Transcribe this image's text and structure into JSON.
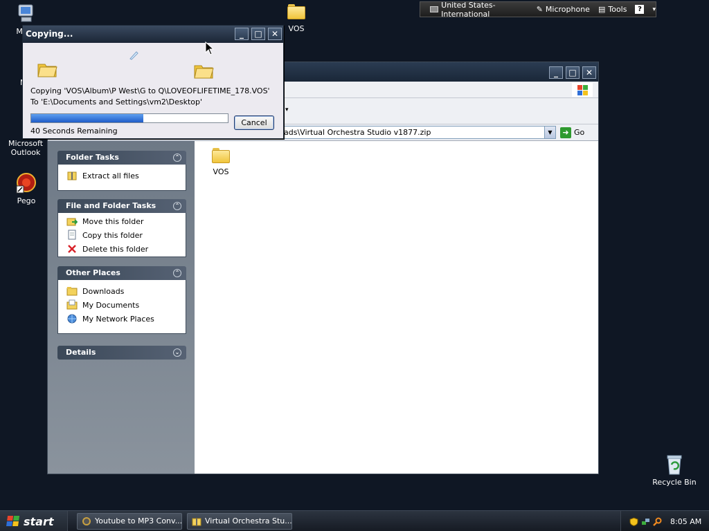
{
  "desktop": {
    "icons": [
      {
        "label": "My C",
        "icon": "my-computer-icon"
      },
      {
        "label": "My",
        "icon": "my-documents-icon"
      },
      {
        "label": "Microsoft Outlook",
        "icon": "outlook-icon"
      },
      {
        "label": "Pego",
        "icon": "pego-icon"
      },
      {
        "label": "VOS",
        "icon": "folder-icon"
      },
      {
        "label": "Recycle Bin",
        "icon": "recycle-bin-icon"
      }
    ]
  },
  "language_bar": {
    "language": "United States-International",
    "microphone": "Microphone",
    "tools": "Tools",
    "help": "?"
  },
  "explorer": {
    "address": "ads\\Virtual Orchestra Studio v1877.zip",
    "go_label": "Go",
    "panels": [
      {
        "title": "Folder Tasks",
        "items": [
          {
            "label": "Extract all files",
            "icon": "extract-icon"
          }
        ]
      },
      {
        "title": "File and Folder Tasks",
        "items": [
          {
            "label": "Move this folder",
            "icon": "move-folder-icon"
          },
          {
            "label": "Copy this folder",
            "icon": "copy-folder-icon"
          },
          {
            "label": "Delete this folder",
            "icon": "delete-icon"
          }
        ]
      },
      {
        "title": "Other Places",
        "items": [
          {
            "label": "Downloads",
            "icon": "folder-icon"
          },
          {
            "label": "My Documents",
            "icon": "my-documents-icon"
          },
          {
            "label": "My Network Places",
            "icon": "network-places-icon"
          }
        ]
      },
      {
        "title": "Details",
        "items": []
      }
    ],
    "content_items": [
      {
        "label": "VOS",
        "icon": "folder-icon"
      }
    ]
  },
  "copy_dialog": {
    "title": "Copying...",
    "line1": "Copying 'VOS\\Album\\P West\\G to Q\\LOVEOFLIFETIME_178.VOS'",
    "line2": "To 'E:\\Documents and Settings\\vm2\\Desktop'",
    "remaining": "40 Seconds Remaining",
    "progress_fraction": 0.57,
    "cancel_label": "Cancel"
  },
  "taskbar": {
    "start_label": "start",
    "tasks": [
      {
        "label": "Youtube to MP3 Conv...",
        "icon": "app-icon"
      },
      {
        "label": "Virtual Orchestra Stu...",
        "icon": "zip-folder-icon"
      }
    ],
    "clock": "8:05 AM"
  }
}
